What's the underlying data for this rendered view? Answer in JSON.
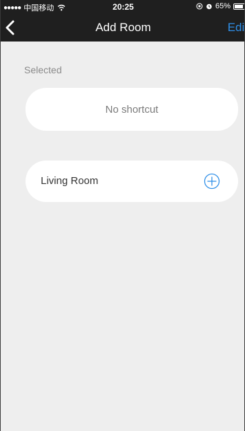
{
  "status_bar": {
    "signal_dots": "●●●●●",
    "carrier": "中国移动",
    "time": "20:25",
    "battery_percent": "65%",
    "battery_level": 0.65
  },
  "nav": {
    "back_icon": "chevron-left-icon",
    "title": "Add Room",
    "edit_label": "Edit"
  },
  "selected_section": {
    "label": "Selected",
    "empty_text": "No shortcut"
  },
  "rooms": [
    {
      "name": "Living Room",
      "action_icon": "add-circle-icon"
    }
  ],
  "colors": {
    "bar_background": "#1f1f1f",
    "accent": "#2f8fe8",
    "page_background": "#eeeeee",
    "card_background": "#ffffff"
  }
}
